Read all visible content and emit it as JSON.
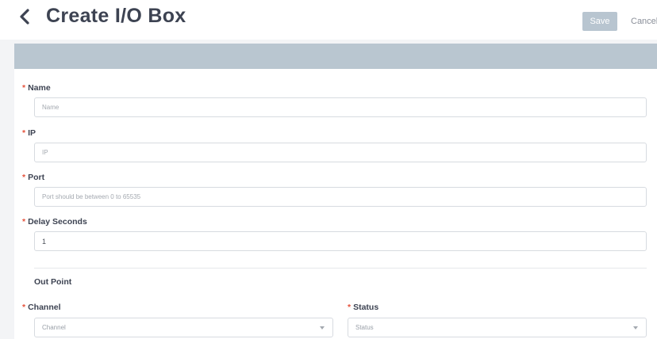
{
  "header": {
    "title": "Create I/O Box",
    "save_label": "Save",
    "cancel_label": "Cancel"
  },
  "form": {
    "required_mark": "*",
    "name": {
      "label": "Name",
      "placeholder": "Name",
      "value": ""
    },
    "ip": {
      "label": "IP",
      "placeholder": "IP",
      "value": ""
    },
    "port": {
      "label": "Port",
      "placeholder": "Port should be between 0 to 65535",
      "value": ""
    },
    "delay_seconds": {
      "label": "Delay Seconds",
      "placeholder": "",
      "value": "1"
    }
  },
  "out_point": {
    "section_title": "Out Point",
    "channel": {
      "label": "Channel",
      "placeholder": "Channel"
    },
    "status": {
      "label": "Status",
      "placeholder": "Status"
    }
  },
  "icons": {
    "back": "chevron-left-icon",
    "dropdown": "caret-down-icon"
  },
  "colors": {
    "required": "#e5533d",
    "save_button": "#b8c5d0",
    "header_band": "#b9c6d0",
    "title_text": "#3d4352"
  }
}
